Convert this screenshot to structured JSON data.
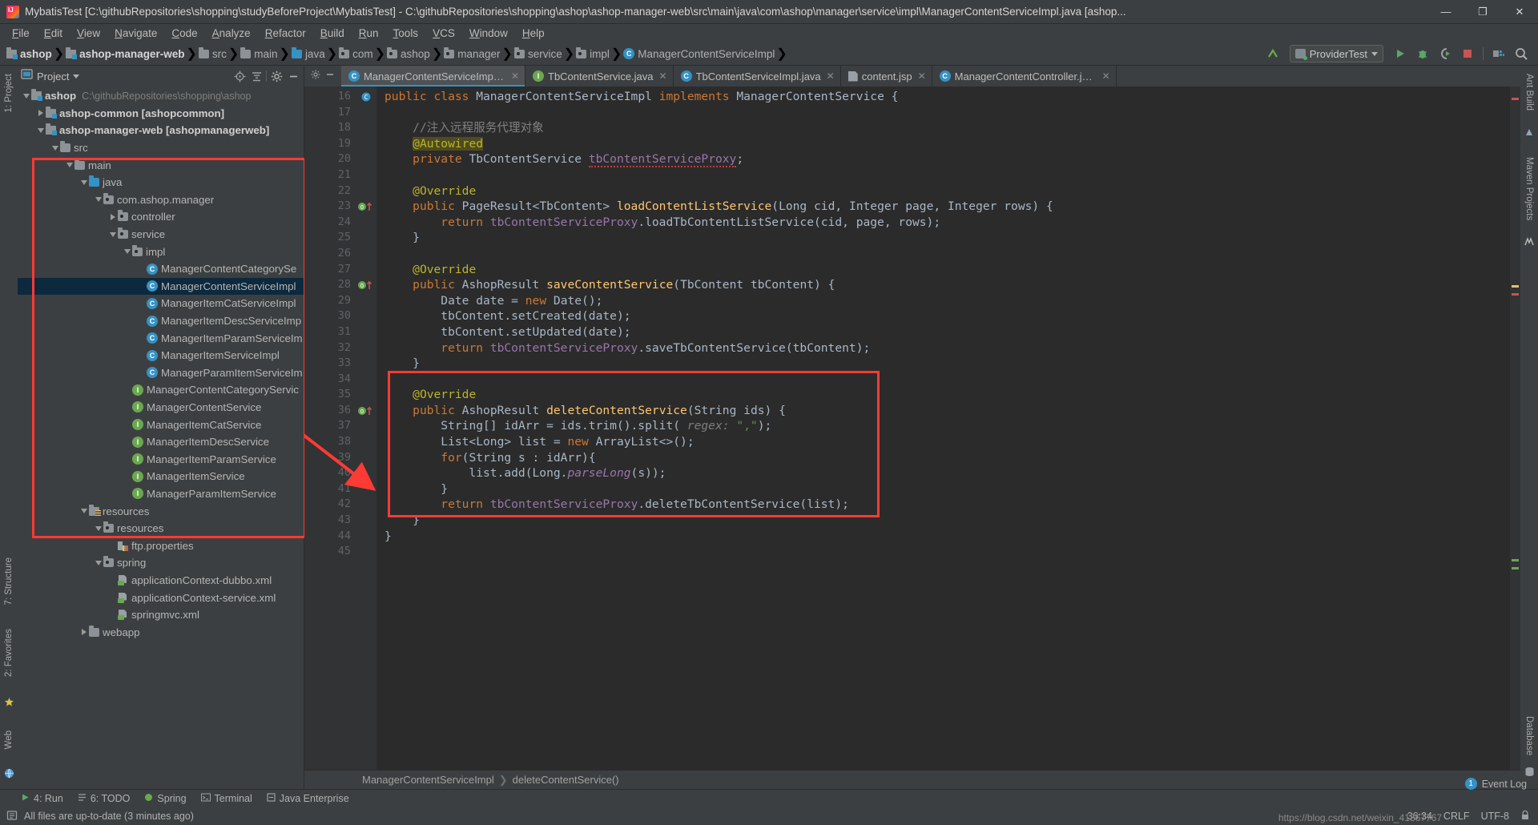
{
  "window": {
    "title": "MybatisTest [C:\\githubRepositories\\shopping\\studyBeforeProject\\MybatisTest] - C:\\githubRepositories\\shopping\\ashop\\ashop-manager-web\\src\\main\\java\\com\\ashop\\manager\\service\\impl\\ManagerContentServiceImpl.java [ashop...",
    "minimize": "—",
    "maximize": "❐",
    "close": "✕"
  },
  "menu": [
    "File",
    "Edit",
    "View",
    "Navigate",
    "Code",
    "Analyze",
    "Refactor",
    "Build",
    "Run",
    "Tools",
    "VCS",
    "Window",
    "Help"
  ],
  "navbar": {
    "crumbs": [
      {
        "label": "ashop",
        "icon": "module-icon",
        "bold": true
      },
      {
        "label": "ashop-manager-web",
        "icon": "module-icon",
        "bold": true
      },
      {
        "label": "src",
        "icon": "folder-icon",
        "bold": false
      },
      {
        "label": "main",
        "icon": "folder-icon",
        "bold": false
      },
      {
        "label": "java",
        "icon": "folder-source-icon",
        "bold": false
      },
      {
        "label": "com",
        "icon": "package-icon",
        "bold": false
      },
      {
        "label": "ashop",
        "icon": "package-icon",
        "bold": false
      },
      {
        "label": "manager",
        "icon": "package-icon",
        "bold": false
      },
      {
        "label": "service",
        "icon": "package-icon",
        "bold": false
      },
      {
        "label": "impl",
        "icon": "package-icon",
        "bold": false
      },
      {
        "label": "ManagerContentServiceImpl",
        "icon": "class-icon",
        "bold": false
      }
    ],
    "run_config": "ProviderTest",
    "icons": [
      "up-arrow-icon",
      "run-icon",
      "debug-icon",
      "run-coverage-icon",
      "stop-icon",
      "project-structure-icon",
      "search-everywhere-icon"
    ]
  },
  "project_panel": {
    "title": "Project",
    "tools": [
      "locate-icon",
      "collapse-all-icon",
      "settings-gear-icon",
      "hide-icon"
    ],
    "tree": [
      {
        "depth": 0,
        "twisty": "down",
        "icon": "module-icon",
        "label": "ashop",
        "bold": true,
        "dim": "C:\\githubRepositories\\shopping\\ashop"
      },
      {
        "depth": 1,
        "twisty": "right",
        "icon": "module-icon",
        "label": "ashop-common [ashopcommon]",
        "bold": true,
        "dim": ""
      },
      {
        "depth": 1,
        "twisty": "down",
        "icon": "module-icon",
        "label": "ashop-manager-web [ashopmanagerweb]",
        "bold": true,
        "dim": ""
      },
      {
        "depth": 2,
        "twisty": "down",
        "icon": "folder-icon",
        "label": "src",
        "bold": false,
        "dim": ""
      },
      {
        "depth": 3,
        "twisty": "down",
        "icon": "folder-icon",
        "label": "main",
        "bold": false,
        "dim": ""
      },
      {
        "depth": 4,
        "twisty": "down",
        "icon": "folder-source-icon",
        "label": "java",
        "bold": false,
        "dim": ""
      },
      {
        "depth": 5,
        "twisty": "down",
        "icon": "package-icon",
        "label": "com.ashop.manager",
        "bold": false,
        "dim": ""
      },
      {
        "depth": 6,
        "twisty": "right",
        "icon": "package-icon",
        "label": "controller",
        "bold": false,
        "dim": ""
      },
      {
        "depth": 6,
        "twisty": "down",
        "icon": "package-icon",
        "label": "service",
        "bold": false,
        "dim": ""
      },
      {
        "depth": 7,
        "twisty": "down",
        "icon": "package-icon",
        "label": "impl",
        "bold": false,
        "dim": ""
      },
      {
        "depth": 8,
        "twisty": "none",
        "icon": "class-icon",
        "label": "ManagerContentCategorySe",
        "bold": false,
        "dim": ""
      },
      {
        "depth": 8,
        "twisty": "none",
        "icon": "class-icon",
        "label": "ManagerContentServiceImpl",
        "bold": false,
        "dim": "",
        "selected": true
      },
      {
        "depth": 8,
        "twisty": "none",
        "icon": "class-icon",
        "label": "ManagerItemCatServiceImpl",
        "bold": false,
        "dim": ""
      },
      {
        "depth": 8,
        "twisty": "none",
        "icon": "class-icon",
        "label": "ManagerItemDescServiceImp",
        "bold": false,
        "dim": ""
      },
      {
        "depth": 8,
        "twisty": "none",
        "icon": "class-icon",
        "label": "ManagerItemParamServiceIm",
        "bold": false,
        "dim": ""
      },
      {
        "depth": 8,
        "twisty": "none",
        "icon": "class-icon",
        "label": "ManagerItemServiceImpl",
        "bold": false,
        "dim": ""
      },
      {
        "depth": 8,
        "twisty": "none",
        "icon": "class-icon",
        "label": "ManagerParamItemServiceIm",
        "bold": false,
        "dim": ""
      },
      {
        "depth": 7,
        "twisty": "none",
        "icon": "interface-icon",
        "label": "ManagerContentCategoryServic",
        "bold": false,
        "dim": ""
      },
      {
        "depth": 7,
        "twisty": "none",
        "icon": "interface-icon",
        "label": "ManagerContentService",
        "bold": false,
        "dim": ""
      },
      {
        "depth": 7,
        "twisty": "none",
        "icon": "interface-icon",
        "label": "ManagerItemCatService",
        "bold": false,
        "dim": ""
      },
      {
        "depth": 7,
        "twisty": "none",
        "icon": "interface-icon",
        "label": "ManagerItemDescService",
        "bold": false,
        "dim": ""
      },
      {
        "depth": 7,
        "twisty": "none",
        "icon": "interface-icon",
        "label": "ManagerItemParamService",
        "bold": false,
        "dim": ""
      },
      {
        "depth": 7,
        "twisty": "none",
        "icon": "interface-icon",
        "label": "ManagerItemService",
        "bold": false,
        "dim": ""
      },
      {
        "depth": 7,
        "twisty": "none",
        "icon": "interface-icon",
        "label": "ManagerParamItemService",
        "bold": false,
        "dim": ""
      },
      {
        "depth": 4,
        "twisty": "down",
        "icon": "resources-icon",
        "label": "resources",
        "bold": false,
        "dim": ""
      },
      {
        "depth": 5,
        "twisty": "down",
        "icon": "package-icon",
        "label": "resources",
        "bold": false,
        "dim": ""
      },
      {
        "depth": 6,
        "twisty": "none",
        "icon": "properties-icon",
        "label": "ftp.properties",
        "bold": false,
        "dim": ""
      },
      {
        "depth": 5,
        "twisty": "down",
        "icon": "package-icon",
        "label": "spring",
        "bold": false,
        "dim": ""
      },
      {
        "depth": 6,
        "twisty": "none",
        "icon": "xml-icon",
        "label": "applicationContext-dubbo.xml",
        "bold": false,
        "dim": ""
      },
      {
        "depth": 6,
        "twisty": "none",
        "icon": "xml-icon",
        "label": "applicationContext-service.xml",
        "bold": false,
        "dim": ""
      },
      {
        "depth": 6,
        "twisty": "none",
        "icon": "xml-icon",
        "label": "springmvc.xml",
        "bold": false,
        "dim": ""
      },
      {
        "depth": 4,
        "twisty": "right",
        "icon": "folder-icon",
        "label": "webapp",
        "bold": false,
        "dim": ""
      }
    ]
  },
  "editor": {
    "tabs": [
      {
        "label": "ManagerContentServiceImpl.java",
        "icon": "class-icon",
        "active": true
      },
      {
        "label": "TbContentService.java",
        "icon": "interface-icon",
        "active": false
      },
      {
        "label": "TbContentServiceImpl.java",
        "icon": "class-icon",
        "active": false
      },
      {
        "label": "content.jsp",
        "icon": "jsp-file-icon",
        "active": false
      },
      {
        "label": "ManagerContentController.java",
        "icon": "class-icon",
        "active": false
      }
    ],
    "first_line_number": 16,
    "lines": [
      {
        "n": 16,
        "html": "<span class=\"kw\">public class </span><span class=\"cls\">ManagerContentServiceImpl </span><span class=\"kw\">implements </span><span class=\"cls\">ManagerContentService </span>{",
        "gutter_icon": "class-marker"
      },
      {
        "n": 17,
        "html": ""
      },
      {
        "n": 18,
        "html": "    <span class=\"cmt\">//注入远程服务代理对象</span>"
      },
      {
        "n": 19,
        "html": "    <span class=\"ann hl-ann\">@Autowired</span>"
      },
      {
        "n": 20,
        "html": "    <span class=\"kw\">private </span>TbContentService <span class=\"fld squig\">tbContentServiceProxy</span>;"
      },
      {
        "n": 21,
        "html": ""
      },
      {
        "n": 22,
        "html": "    <span class=\"ann\">@Override</span>"
      },
      {
        "n": 23,
        "html": "    <span class=\"kw\">public </span>PageResult&lt;TbContent&gt; <span class=\"mth\">loadContentListService</span>(<span class=\"cls\">Long </span>cid, <span class=\"cls\">Integer </span>page, <span class=\"cls\">Integer </span>rows) {",
        "gutter_icon": "override-marker",
        "fold": true
      },
      {
        "n": 24,
        "html": "        <span class=\"kw\">return </span><span class=\"fld\">tbContentServiceProxy</span>.loadTbContentListService(cid, page, rows);"
      },
      {
        "n": 25,
        "html": "    }",
        "fold_end": true
      },
      {
        "n": 26,
        "html": ""
      },
      {
        "n": 27,
        "html": "    <span class=\"ann\">@Override</span>"
      },
      {
        "n": 28,
        "html": "    <span class=\"kw\">public </span>AshopResult <span class=\"mth\">saveContentService</span>(<span class=\"cls\">TbContent </span>tbContent) {",
        "gutter_icon": "override-marker",
        "fold": true
      },
      {
        "n": 29,
        "html": "        <span class=\"cls\">Date </span>date = <span class=\"kw\">new </span>Date();"
      },
      {
        "n": 30,
        "html": "        tbContent.setCreated(date);"
      },
      {
        "n": 31,
        "html": "        tbContent.setUpdated(date);"
      },
      {
        "n": 32,
        "html": "        <span class=\"kw\">return </span><span class=\"fld\">tbContentServiceProxy</span>.saveTbContentService(tbContent);"
      },
      {
        "n": 33,
        "html": "    }",
        "fold_end": true
      },
      {
        "n": 34,
        "html": ""
      },
      {
        "n": 35,
        "html": "    <span class=\"ann\">@Override</span>"
      },
      {
        "n": 36,
        "html": "    <span class=\"kw\">public </span>AshopResult <span class=\"mth\">deleteContentService</span>(<span class=\"cls\">String </span>ids) {",
        "gutter_icon": "override-marker",
        "fold": true
      },
      {
        "n": 37,
        "html": "        <span class=\"cls\">String</span>[] idArr = ids.trim().split( <span class=\"param-hint\">regex:</span> <span class=\"str\">\",\"</span>);"
      },
      {
        "n": 38,
        "html": "        List&lt;Long&gt; list = <span class=\"kw\">new </span>ArrayList&lt;&gt;();"
      },
      {
        "n": 39,
        "html": "        <span class=\"kw\">for</span>(<span class=\"cls\">String </span>s : idArr){"
      },
      {
        "n": 40,
        "html": "            list.add(Long.<span class=\"stc\">parseLong</span>(s));"
      },
      {
        "n": 41,
        "html": "        }"
      },
      {
        "n": 42,
        "html": "        <span class=\"kw\">return </span><span class=\"fld\">tbContentServiceProxy</span>.deleteTbContentService(list);"
      },
      {
        "n": 43,
        "html": "    }",
        "fold_end": true
      },
      {
        "n": 44,
        "html": "}"
      },
      {
        "n": 45,
        "html": ""
      }
    ],
    "breadcrumb": [
      "ManagerContentServiceImpl",
      "deleteContentService()"
    ]
  },
  "left_strip": {
    "top": "1: Project",
    "bottom_items": [
      "7: Structure",
      "2: Favorites",
      "Web"
    ]
  },
  "right_strip": {
    "items": [
      "Ant Build",
      "Maven Projects",
      "Database"
    ]
  },
  "toolwindow_bar": [
    {
      "label": "4: Run",
      "icon": "run-icon"
    },
    {
      "label": "6: TODO",
      "icon": "todo-icon"
    },
    {
      "label": "Spring",
      "icon": "spring-icon"
    },
    {
      "label": "Terminal",
      "icon": "terminal-icon"
    },
    {
      "label": "Java Enterprise",
      "icon": "java-ee-icon"
    }
  ],
  "statusbar": {
    "message": "All files are up-to-date (3 minutes ago)",
    "position": "36:34",
    "line_sep": "CRLF",
    "encoding": "UTF-8",
    "event_log": "Event Log",
    "event_count": "1",
    "watermark": "https://blog.csdn.net/weixin_41367767"
  }
}
